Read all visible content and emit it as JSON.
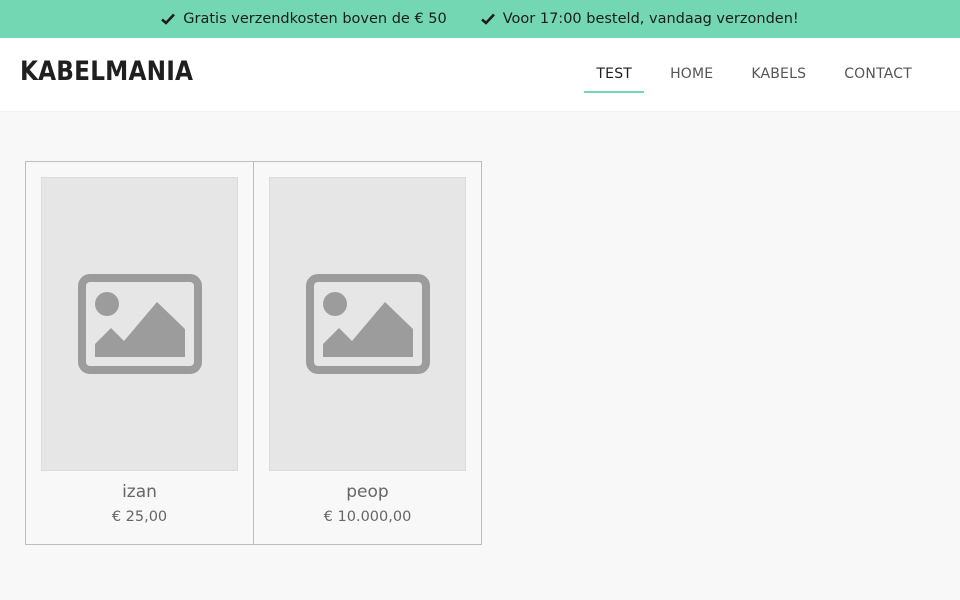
{
  "topbar": {
    "items": [
      {
        "icon": "check-icon",
        "text": "Gratis verzendkosten boven de € 50"
      },
      {
        "icon": "check-icon",
        "text": "Voor 17:00 besteld, vandaag verzonden!"
      }
    ],
    "background": "#74d7b4"
  },
  "header": {
    "logo": "KABELMANIA",
    "nav": [
      {
        "label": "TEST",
        "active": true
      },
      {
        "label": "HOME",
        "active": false
      },
      {
        "label": "KABELS",
        "active": false
      },
      {
        "label": "CONTACT",
        "active": false
      }
    ]
  },
  "products": [
    {
      "name": "izan",
      "price": "€ 25,00",
      "image": "image-placeholder-icon"
    },
    {
      "name": "peop",
      "price": "€ 10.000,00",
      "image": "image-placeholder-icon"
    }
  ],
  "colors": {
    "accent": "#74d7b4",
    "page_background": "#f8f8f8",
    "placeholder": "#e6e6e6"
  }
}
